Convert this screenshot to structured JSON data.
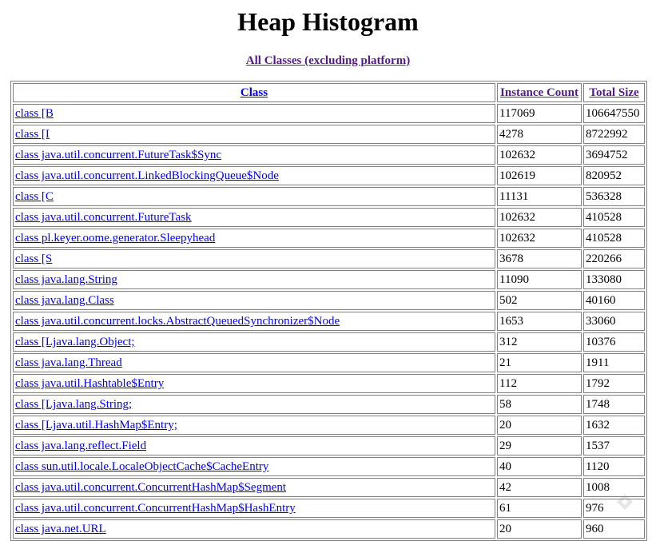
{
  "page": {
    "title": "Heap Histogram",
    "all_classes_link": "All Classes (excluding platform)"
  },
  "table": {
    "headers": {
      "class": "Class",
      "instance_count": "Instance Count",
      "total_size": "Total Size"
    },
    "rows": [
      {
        "class": "class [B",
        "count": "117069",
        "size": "106647550"
      },
      {
        "class": "class [I",
        "count": "4278",
        "size": "8722992"
      },
      {
        "class": "class java.util.concurrent.FutureTask$Sync",
        "count": "102632",
        "size": "3694752"
      },
      {
        "class": "class java.util.concurrent.LinkedBlockingQueue$Node",
        "count": "102619",
        "size": "820952"
      },
      {
        "class": "class [C",
        "count": "11131",
        "size": "536328"
      },
      {
        "class": "class java.util.concurrent.FutureTask",
        "count": "102632",
        "size": "410528"
      },
      {
        "class": "class pl.keyer.oome.generator.Sleepyhead",
        "count": "102632",
        "size": "410528"
      },
      {
        "class": "class [S",
        "count": "3678",
        "size": "220266"
      },
      {
        "class": "class java.lang.String",
        "count": "11090",
        "size": "133080"
      },
      {
        "class": "class java.lang.Class",
        "count": "502",
        "size": "40160"
      },
      {
        "class": "class java.util.concurrent.locks.AbstractQueuedSynchronizer$Node",
        "count": "1653",
        "size": "33060"
      },
      {
        "class": "class [Ljava.lang.Object;",
        "count": "312",
        "size": "10376"
      },
      {
        "class": "class java.lang.Thread",
        "count": "21",
        "size": "1911"
      },
      {
        "class": "class java.util.Hashtable$Entry",
        "count": "112",
        "size": "1792"
      },
      {
        "class": "class [Ljava.lang.String;",
        "count": "58",
        "size": "1748"
      },
      {
        "class": "class [Ljava.util.HashMap$Entry;",
        "count": "20",
        "size": "1632"
      },
      {
        "class": "class java.lang.reflect.Field",
        "count": "29",
        "size": "1537"
      },
      {
        "class": "class sun.util.locale.LocaleObjectCache$CacheEntry",
        "count": "40",
        "size": "1120"
      },
      {
        "class": "class java.util.concurrent.ConcurrentHashMap$Segment",
        "count": "42",
        "size": "1008"
      },
      {
        "class": "class java.util.concurrent.ConcurrentHashMap$HashEntry",
        "count": "61",
        "size": "976"
      },
      {
        "class": "class java.net.URL",
        "count": "20",
        "size": "960"
      }
    ]
  },
  "colors": {
    "visited_link": "#551a8b",
    "link": "#0000ee",
    "border": "#808080"
  }
}
